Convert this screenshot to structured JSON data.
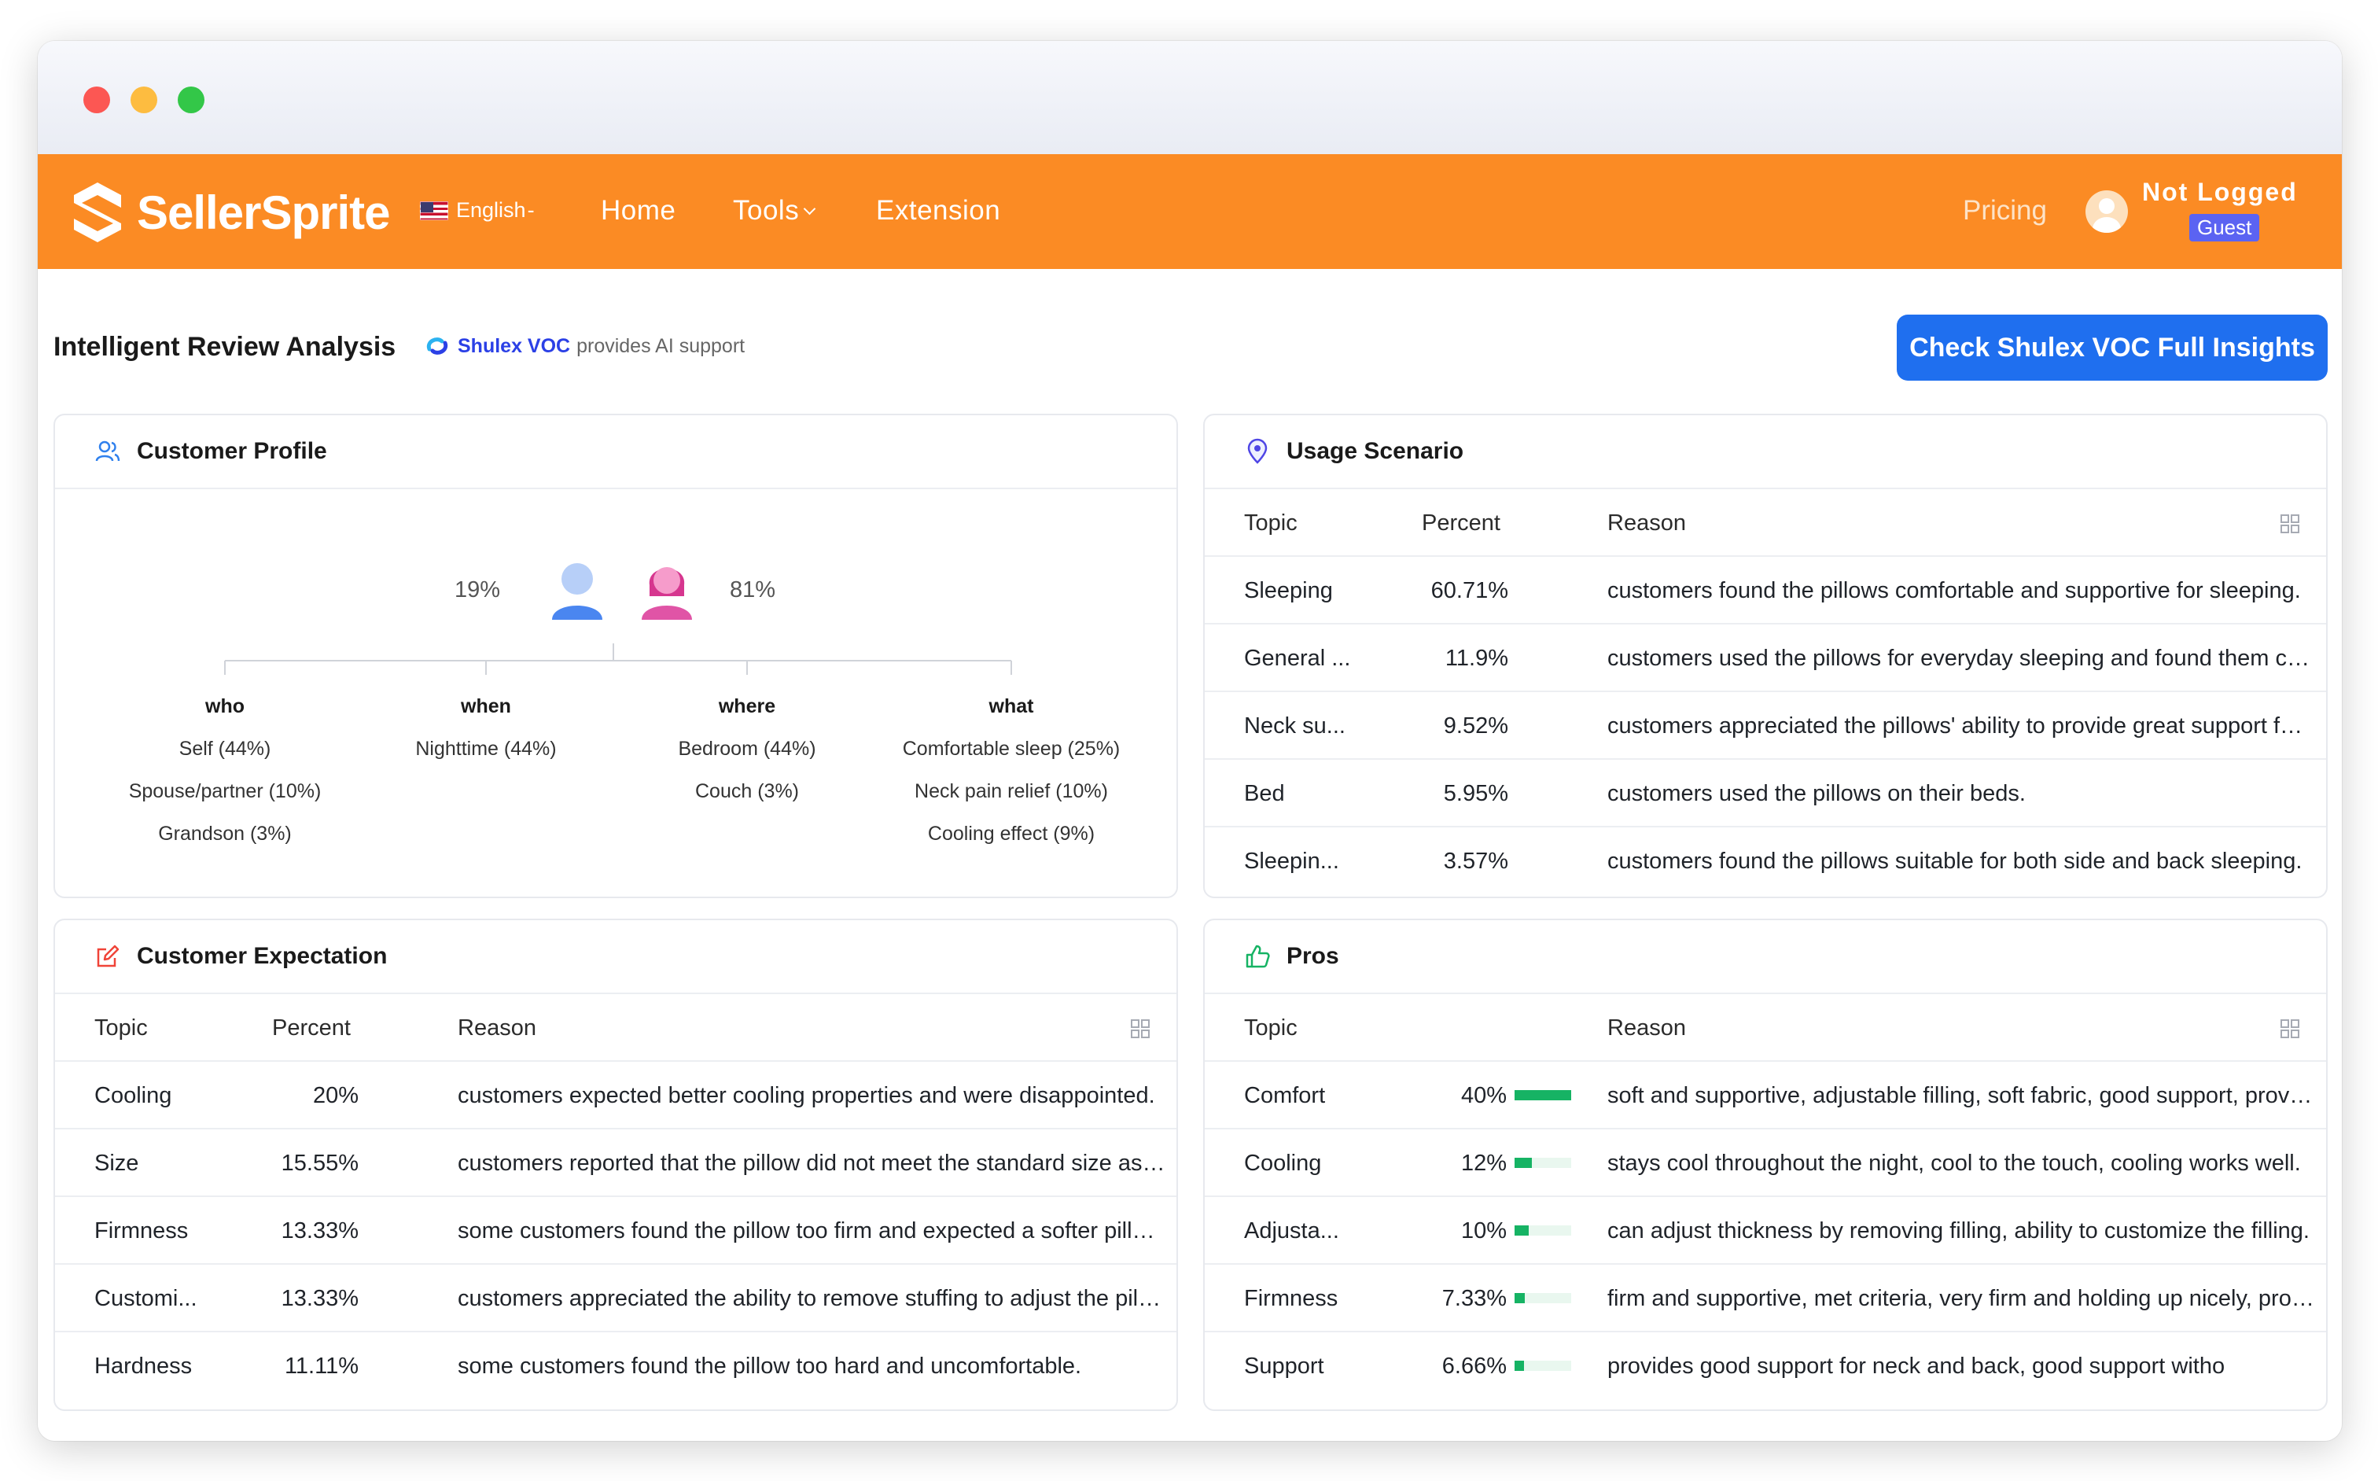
{
  "window": {
    "traffic_lights": [
      "close",
      "minimize",
      "maximize"
    ]
  },
  "nav": {
    "brand": "SellerSprite",
    "language": "English",
    "links": {
      "home": "Home",
      "tools": "Tools",
      "extension": "Extension"
    },
    "pricing": "Pricing",
    "user_status": "Not Logged",
    "user_badge": "Guest"
  },
  "header": {
    "title": "Intelligent Review Analysis",
    "provider_name": "Shulex VOC",
    "provider_note": "provides AI support",
    "cta": "Check Shulex VOC Full Insights"
  },
  "customer_profile": {
    "title": "Customer Profile",
    "male_percent": "19%",
    "female_percent": "81%",
    "columns": [
      {
        "heading": "who",
        "items": [
          "Self (44%)",
          "Spouse/partner (10%)",
          "Grandson (3%)"
        ]
      },
      {
        "heading": "when",
        "items": [
          "Nighttime (44%)"
        ]
      },
      {
        "heading": "where",
        "items": [
          "Bedroom (44%)",
          "Couch (3%)"
        ]
      },
      {
        "heading": "what",
        "items": [
          "Comfortable sleep (25%)",
          "Neck pain relief (10%)",
          "Cooling effect (9%)"
        ]
      }
    ]
  },
  "usage_scenario": {
    "title": "Usage Scenario",
    "headers": {
      "topic": "Topic",
      "percent": "Percent",
      "reason": "Reason"
    },
    "rows": [
      {
        "topic": "Sleeping",
        "percent": "60.71%",
        "reason": "customers found the pillows comfortable and supportive for sleeping."
      },
      {
        "topic": "General ...",
        "percent": "11.9%",
        "reason": "customers used the pillows for everyday sleeping and found them comfortable."
      },
      {
        "topic": "Neck su...",
        "percent": "9.52%",
        "reason": "customers appreciated the pillows' ability to provide great support for the neck."
      },
      {
        "topic": "Bed",
        "percent": "5.95%",
        "reason": "customers used the pillows on their beds."
      },
      {
        "topic": "Sleepin...",
        "percent": "3.57%",
        "reason": "customers found the pillows suitable for both side and back sleeping."
      }
    ]
  },
  "customer_expectation": {
    "title": "Customer Expectation",
    "headers": {
      "topic": "Topic",
      "percent": "Percent",
      "reason": "Reason"
    },
    "rows": [
      {
        "topic": "Cooling",
        "percent": "20%",
        "reason": "customers expected better cooling properties and were disappointed."
      },
      {
        "topic": "Size",
        "percent": "15.55%",
        "reason": "customers reported that the pillow did not meet the standard size as described."
      },
      {
        "topic": "Firmness",
        "percent": "13.33%",
        "reason": "some customers found the pillow too firm and expected a softer pillow."
      },
      {
        "topic": "Customi...",
        "percent": "13.33%",
        "reason": "customers appreciated the ability to remove stuffing to adjust the pillow."
      },
      {
        "topic": "Hardness",
        "percent": "11.11%",
        "reason": "some customers found the pillow too hard and uncomfortable."
      }
    ]
  },
  "pros": {
    "title": "Pros",
    "headers": {
      "topic": "Topic",
      "reason": "Reason"
    },
    "rows": [
      {
        "topic": "Comfort",
        "percent": "40%",
        "level": 1.0,
        "reason": "soft and supportive, adjustable filling, soft fabric, good support, provides comfort."
      },
      {
        "topic": "Cooling",
        "percent": "12%",
        "level": 0.3,
        "reason": "stays cool throughout the night, cool to the touch, cooling works well."
      },
      {
        "topic": "Adjusta...",
        "percent": "10%",
        "level": 0.25,
        "reason": "can adjust thickness by removing filling, ability to customize the filling."
      },
      {
        "topic": "Firmness",
        "percent": "7.33%",
        "level": 0.18,
        "reason": "firm and supportive, met criteria, very firm and holding up nicely, protects neck."
      },
      {
        "topic": "Support",
        "percent": "6.66%",
        "level": 0.17,
        "reason": "provides good support for neck and back, good support witho"
      }
    ]
  },
  "colors": {
    "nav": "#fb8b24",
    "cta": "#1f6fef",
    "bar": "#16b364",
    "male": "#4a86f0",
    "female": "#e054a6"
  }
}
